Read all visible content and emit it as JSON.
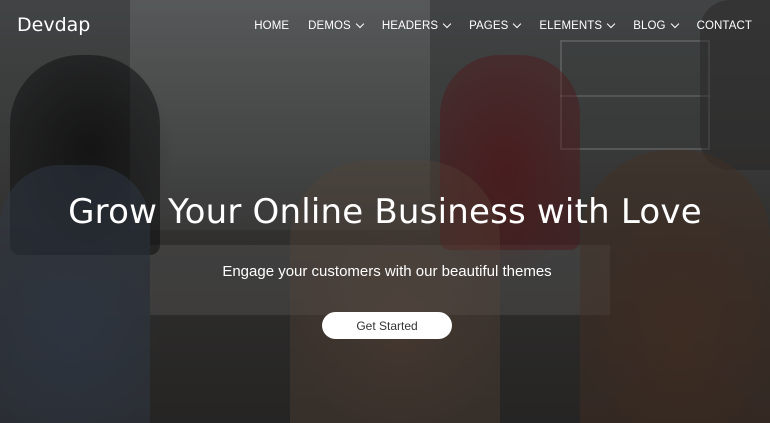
{
  "brand": {
    "name": "Devdap"
  },
  "nav": {
    "items": [
      {
        "label": "HOME",
        "dropdown": false
      },
      {
        "label": "DEMOS",
        "dropdown": true
      },
      {
        "label": "HEADERS",
        "dropdown": true
      },
      {
        "label": "PAGES",
        "dropdown": true
      },
      {
        "label": "ELEMENTS",
        "dropdown": true
      },
      {
        "label": "BLOG",
        "dropdown": true
      },
      {
        "label": "CONTACT",
        "dropdown": false
      }
    ]
  },
  "hero": {
    "headline": "Grow Your Online Business with Love",
    "subheadline": "Engage your customers with our beautiful themes",
    "cta_label": "Get Started",
    "text_color": "#ffffff",
    "cta_background": "#ffffff",
    "cta_text_color": "#333333"
  }
}
